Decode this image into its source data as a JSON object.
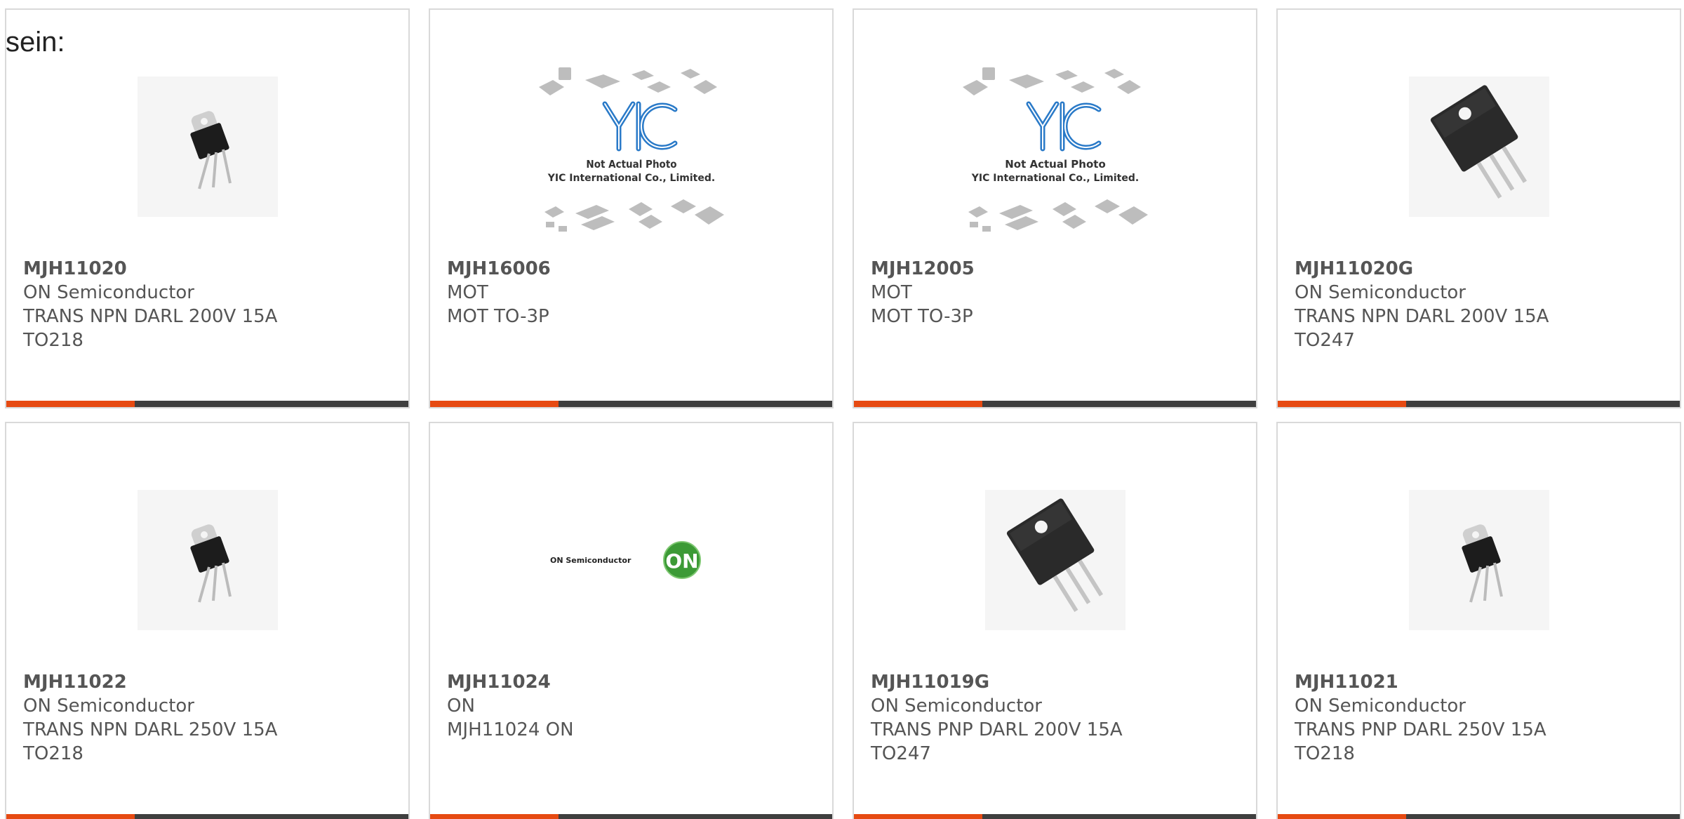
{
  "intro_text": "sein:",
  "colors": {
    "accent": "#e64a12",
    "bar": "#3f3f3f",
    "yic_blue": "#2a7ac8",
    "on_green": "#3c9a36"
  },
  "placeholder": {
    "line1": "Not Actual Photo",
    "line2": "YIC International Co., Limited.",
    "logo": "YIC"
  },
  "on_logo": {
    "wordmark": "ON Semiconductor",
    "badge": "ON"
  },
  "products": [
    {
      "part": "MJH11020",
      "maker": "ON Semiconductor",
      "desc": "TRANS NPN DARL 200V 15A",
      "pkg": "TO218",
      "image": "to218-transistor-icon"
    },
    {
      "part": "MJH16006",
      "maker": "MOT",
      "desc": "MOT TO-3P",
      "pkg": "",
      "image": "not-actual-photo-icon"
    },
    {
      "part": "MJH12005",
      "maker": "MOT",
      "desc": "MOT TO-3P",
      "pkg": "",
      "image": "not-actual-photo-icon"
    },
    {
      "part": "MJH11020G",
      "maker": "ON Semiconductor",
      "desc": "TRANS NPN DARL 200V 15A",
      "pkg": "TO247",
      "image": "to247-transistor-icon"
    },
    {
      "part": "MJH11022",
      "maker": "ON Semiconductor",
      "desc": "TRANS NPN DARL 250V 15A",
      "pkg": "TO218",
      "image": "to218-transistor-icon"
    },
    {
      "part": "MJH11024",
      "maker": "ON",
      "desc": "MJH11024 ON",
      "pkg": "",
      "image": "on-semiconductor-logo"
    },
    {
      "part": "MJH11019G",
      "maker": "ON Semiconductor",
      "desc": "TRANS PNP DARL 200V 15A",
      "pkg": "TO247",
      "image": "to247-transistor-icon"
    },
    {
      "part": "MJH11021",
      "maker": "ON Semiconductor",
      "desc": "TRANS PNP DARL 250V 15A",
      "pkg": "TO218",
      "image": "to218-transistor-icon"
    }
  ]
}
